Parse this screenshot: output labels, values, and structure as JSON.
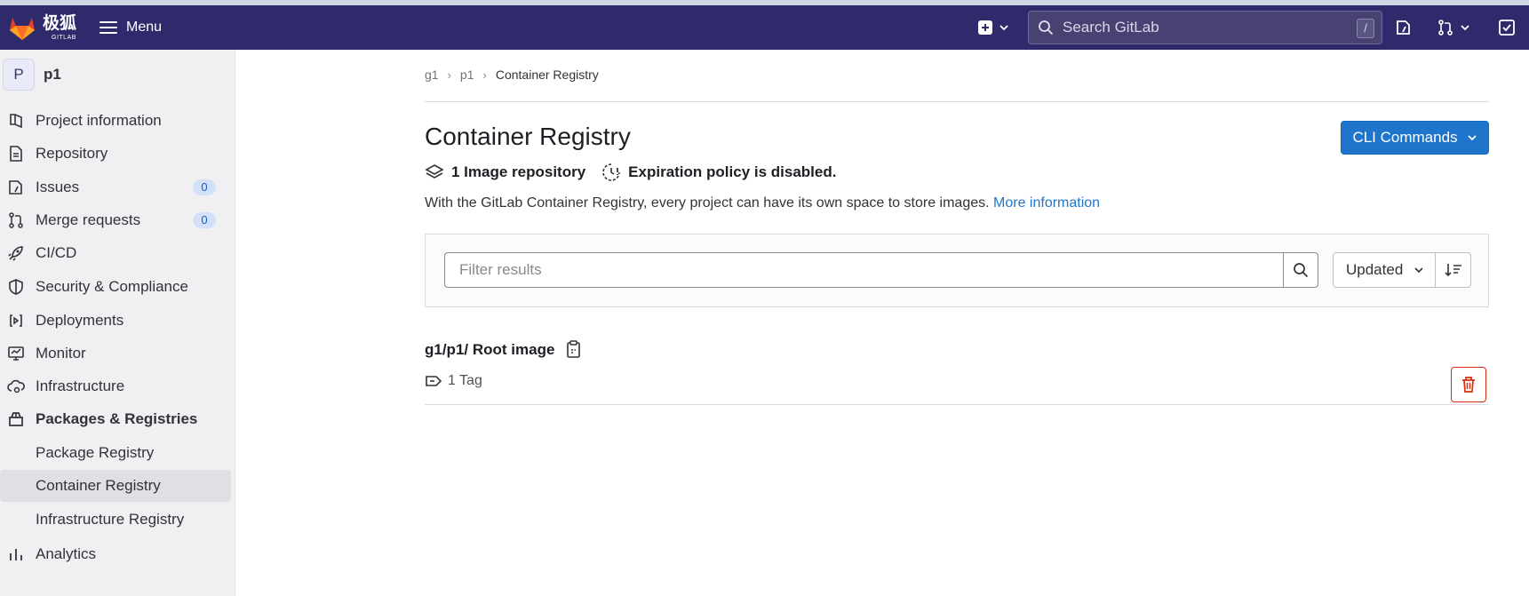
{
  "brand": {
    "name": "极狐",
    "sub": "GITLAB"
  },
  "topbar": {
    "menu_label": "Menu",
    "search_placeholder": "Search GitLab",
    "search_shortcut": "/"
  },
  "sidebar": {
    "project_initial": "P",
    "project_name": "p1",
    "items": [
      {
        "label": "Project information",
        "icon": "project-icon"
      },
      {
        "label": "Repository",
        "icon": "doc-icon"
      },
      {
        "label": "Issues",
        "icon": "issues-icon",
        "count": "0"
      },
      {
        "label": "Merge requests",
        "icon": "merge-request-icon",
        "count": "0"
      },
      {
        "label": "CI/CD",
        "icon": "rocket-icon"
      },
      {
        "label": "Security & Compliance",
        "icon": "shield-icon"
      },
      {
        "label": "Deployments",
        "icon": "deployments-icon"
      },
      {
        "label": "Monitor",
        "icon": "monitor-icon"
      },
      {
        "label": "Infrastructure",
        "icon": "cloud-gear-icon"
      },
      {
        "label": "Packages & Registries",
        "icon": "package-icon"
      },
      {
        "label": "Package Registry"
      },
      {
        "label": "Container Registry"
      },
      {
        "label": "Infrastructure Registry"
      },
      {
        "label": "Analytics",
        "icon": "chart-icon"
      }
    ]
  },
  "breadcrumb": [
    "g1",
    "p1",
    "Container Registry"
  ],
  "page": {
    "title": "Container Registry",
    "cli_button": "CLI Commands",
    "image_count_text": "1 Image repository",
    "expiration_text": "Expiration policy is disabled.",
    "description": "With the GitLab Container Registry, every project can have its own space to store images.",
    "more_info_link": "More information"
  },
  "filter": {
    "placeholder": "Filter results",
    "sort_label": "Updated"
  },
  "images": [
    {
      "name": "g1/p1/ Root image",
      "tags": "1 Tag"
    }
  ],
  "colors": {
    "topbar": "#2f2a6b",
    "primary": "#1f75cb",
    "danger": "#dd2b0e"
  }
}
